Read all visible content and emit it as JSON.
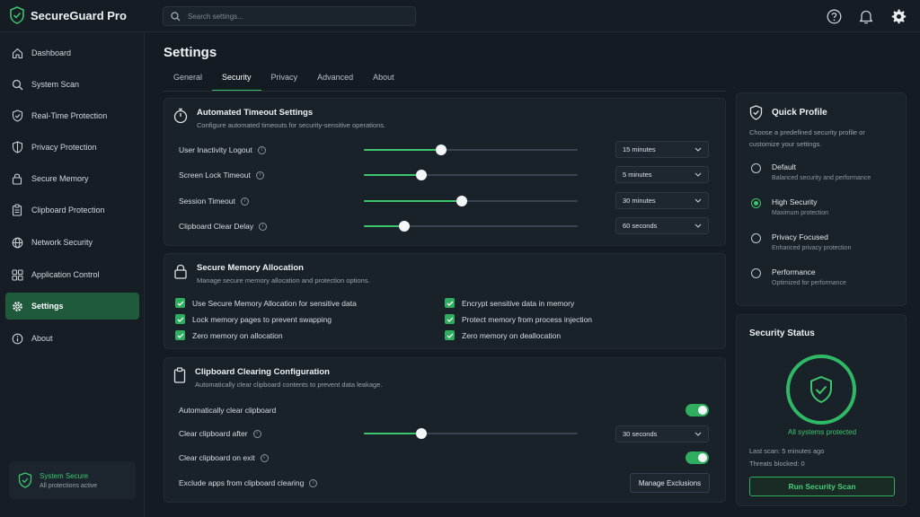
{
  "app": {
    "name": "SecureGuard Pro"
  },
  "search": {
    "placeholder": "Search settings..."
  },
  "sidebar": {
    "items": [
      {
        "label": "Dashboard",
        "icon": "home-icon"
      },
      {
        "label": "System Scan",
        "icon": "search-icon"
      },
      {
        "label": "Real-Time Protection",
        "icon": "shield-check-icon"
      },
      {
        "label": "Privacy Protection",
        "icon": "privacy-icon"
      },
      {
        "label": "Secure Memory",
        "icon": "lock-icon"
      },
      {
        "label": "Clipboard Protection",
        "icon": "clipboard-icon"
      },
      {
        "label": "Network Security",
        "icon": "globe-icon"
      },
      {
        "label": "Application Control",
        "icon": "apps-icon"
      },
      {
        "label": "Settings",
        "icon": "gear-icon",
        "active": true
      },
      {
        "label": "About",
        "icon": "info-icon"
      }
    ],
    "status": {
      "title": "System Secure",
      "subtitle": "All protections active"
    }
  },
  "page": {
    "title": "Settings"
  },
  "tabs": [
    {
      "label": "General"
    },
    {
      "label": "Security",
      "active": true
    },
    {
      "label": "Privacy"
    },
    {
      "label": "Advanced"
    },
    {
      "label": "About"
    }
  ],
  "timeout": {
    "title": "Automated Timeout Settings",
    "subtitle": "Configure automated timeouts for security-sensitive operations.",
    "rows": [
      {
        "label": "User Inactivity Logout",
        "value": "15 minutes",
        "level": 0.36
      },
      {
        "label": "Screen Lock Timeout",
        "value": "5 minutes",
        "level": 0.27
      },
      {
        "label": "Session Timeout",
        "value": "30 minutes",
        "level": 0.46
      },
      {
        "label": "Clipboard Clear Delay",
        "value": "60 seconds",
        "level": 0.19
      }
    ]
  },
  "memory": {
    "title": "Secure Memory Allocation",
    "subtitle": "Manage secure memory allocation and protection options.",
    "options": [
      {
        "label": "Use Secure Memory Allocation for sensitive data",
        "checked": true
      },
      {
        "label": "Encrypt sensitive data in memory",
        "checked": true
      },
      {
        "label": "Lock memory pages to prevent swapping",
        "checked": true
      },
      {
        "label": "Protect memory from process injection",
        "checked": true
      },
      {
        "label": "Zero memory on allocation",
        "checked": true
      },
      {
        "label": "Zero memory on deallocation",
        "checked": true
      }
    ]
  },
  "clipboard": {
    "title": "Clipboard Clearing Configuration",
    "subtitle": "Automatically clear clipboard contents to prevent data leakage.",
    "auto_clear_label": "Automatically clear clipboard",
    "auto_clear_on": true,
    "clear_after_label": "Clear clipboard after",
    "clear_after_value": "30 seconds",
    "clear_after_level": 0.27,
    "clear_on_exit_label": "Clear clipboard on exit",
    "clear_on_exit_on": true,
    "exclude_label": "Exclude apps from clipboard clearing",
    "manage_label": "Manage Exclusions"
  },
  "quick_profile": {
    "title": "Quick Profile",
    "description": "Choose a predefined security profile or customize your settings.",
    "options": [
      {
        "label": "Default",
        "desc": "Balanced security and performance",
        "selected": false
      },
      {
        "label": "High Security",
        "desc": "Maximum protection",
        "selected": true
      },
      {
        "label": "Privacy Focused",
        "desc": "Enhanced privacy protection",
        "selected": false
      },
      {
        "label": "Performance",
        "desc": "Optimized for performance",
        "selected": false
      }
    ]
  },
  "security_status": {
    "title": "Security Status",
    "status": "All systems protected",
    "last_scan": "Last scan: 5 minutes ago",
    "threats": "Threats blocked: 0",
    "scan_button": "Run Security Scan"
  },
  "colors": {
    "accent": "#3ec46d",
    "active_nav": "#1f5a3c",
    "background": "#141b22"
  }
}
